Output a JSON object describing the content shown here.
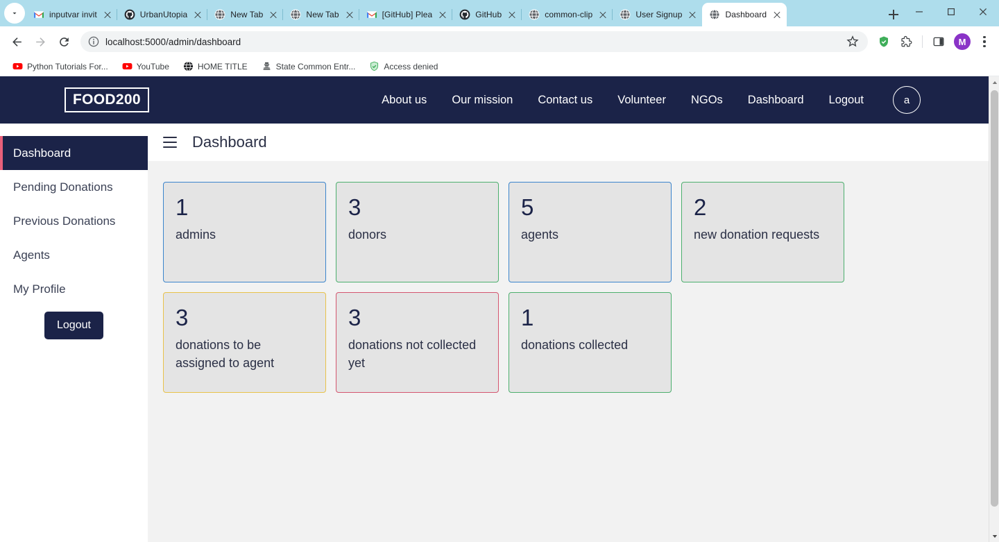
{
  "browser": {
    "tabs": [
      {
        "title": "inputvar invit",
        "icon": "gmail-icon",
        "active": false
      },
      {
        "title": "UrbanUtopia",
        "icon": "github-icon",
        "active": false
      },
      {
        "title": "New Tab",
        "icon": "chrome-globe-icon",
        "active": false
      },
      {
        "title": "New Tab",
        "icon": "chrome-globe-icon",
        "active": false
      },
      {
        "title": "[GitHub] Plea",
        "icon": "gmail-icon",
        "active": false
      },
      {
        "title": "GitHub",
        "icon": "github-icon",
        "active": false
      },
      {
        "title": "common-clip",
        "icon": "chrome-globe-icon",
        "active": false
      },
      {
        "title": "User Signup",
        "icon": "chrome-globe-icon",
        "active": false
      },
      {
        "title": "Dashboard",
        "icon": "chrome-globe-icon",
        "active": true
      }
    ],
    "url": "localhost:5000/admin/dashboard",
    "profile_initial": "M",
    "bookmarks": [
      {
        "title": "Python Tutorials For...",
        "icon": "youtube-icon"
      },
      {
        "title": "YouTube",
        "icon": "youtube-icon"
      },
      {
        "title": "HOME TITLE",
        "icon": "globe-icon"
      },
      {
        "title": "State Common Entr...",
        "icon": "emblem-icon"
      },
      {
        "title": "Access denied",
        "icon": "shield-check-icon"
      }
    ]
  },
  "site": {
    "brand": "FOOD200",
    "nav": [
      "About us",
      "Our mission",
      "Contact us",
      "Volunteer",
      "NGOs",
      "Dashboard",
      "Logout"
    ],
    "avatar_initial": "a",
    "nav_bg": "#1b2348"
  },
  "sidebar": {
    "items": [
      {
        "label": "Dashboard",
        "active": true
      },
      {
        "label": "Pending Donations",
        "active": false
      },
      {
        "label": "Previous Donations",
        "active": false
      },
      {
        "label": "Agents",
        "active": false
      },
      {
        "label": "My Profile",
        "active": false
      }
    ],
    "logout_label": "Logout",
    "active_accent": "#e9607a"
  },
  "main": {
    "page_title": "Dashboard",
    "cards": [
      {
        "value": "1",
        "label": "admins",
        "border": "#3a84cc"
      },
      {
        "value": "3",
        "label": "donors",
        "border": "#4caf6d"
      },
      {
        "value": "5",
        "label": "agents",
        "border": "#3a84cc"
      },
      {
        "value": "2",
        "label": "new donation requests",
        "border": "#4caf6d"
      },
      {
        "value": "3",
        "label": "donations to be assigned to agent",
        "border": "#e8c24a"
      },
      {
        "value": "3",
        "label": "donations not collected yet",
        "border": "#d4566f"
      },
      {
        "value": "1",
        "label": "donations collected",
        "border": "#4caf6d"
      }
    ]
  }
}
